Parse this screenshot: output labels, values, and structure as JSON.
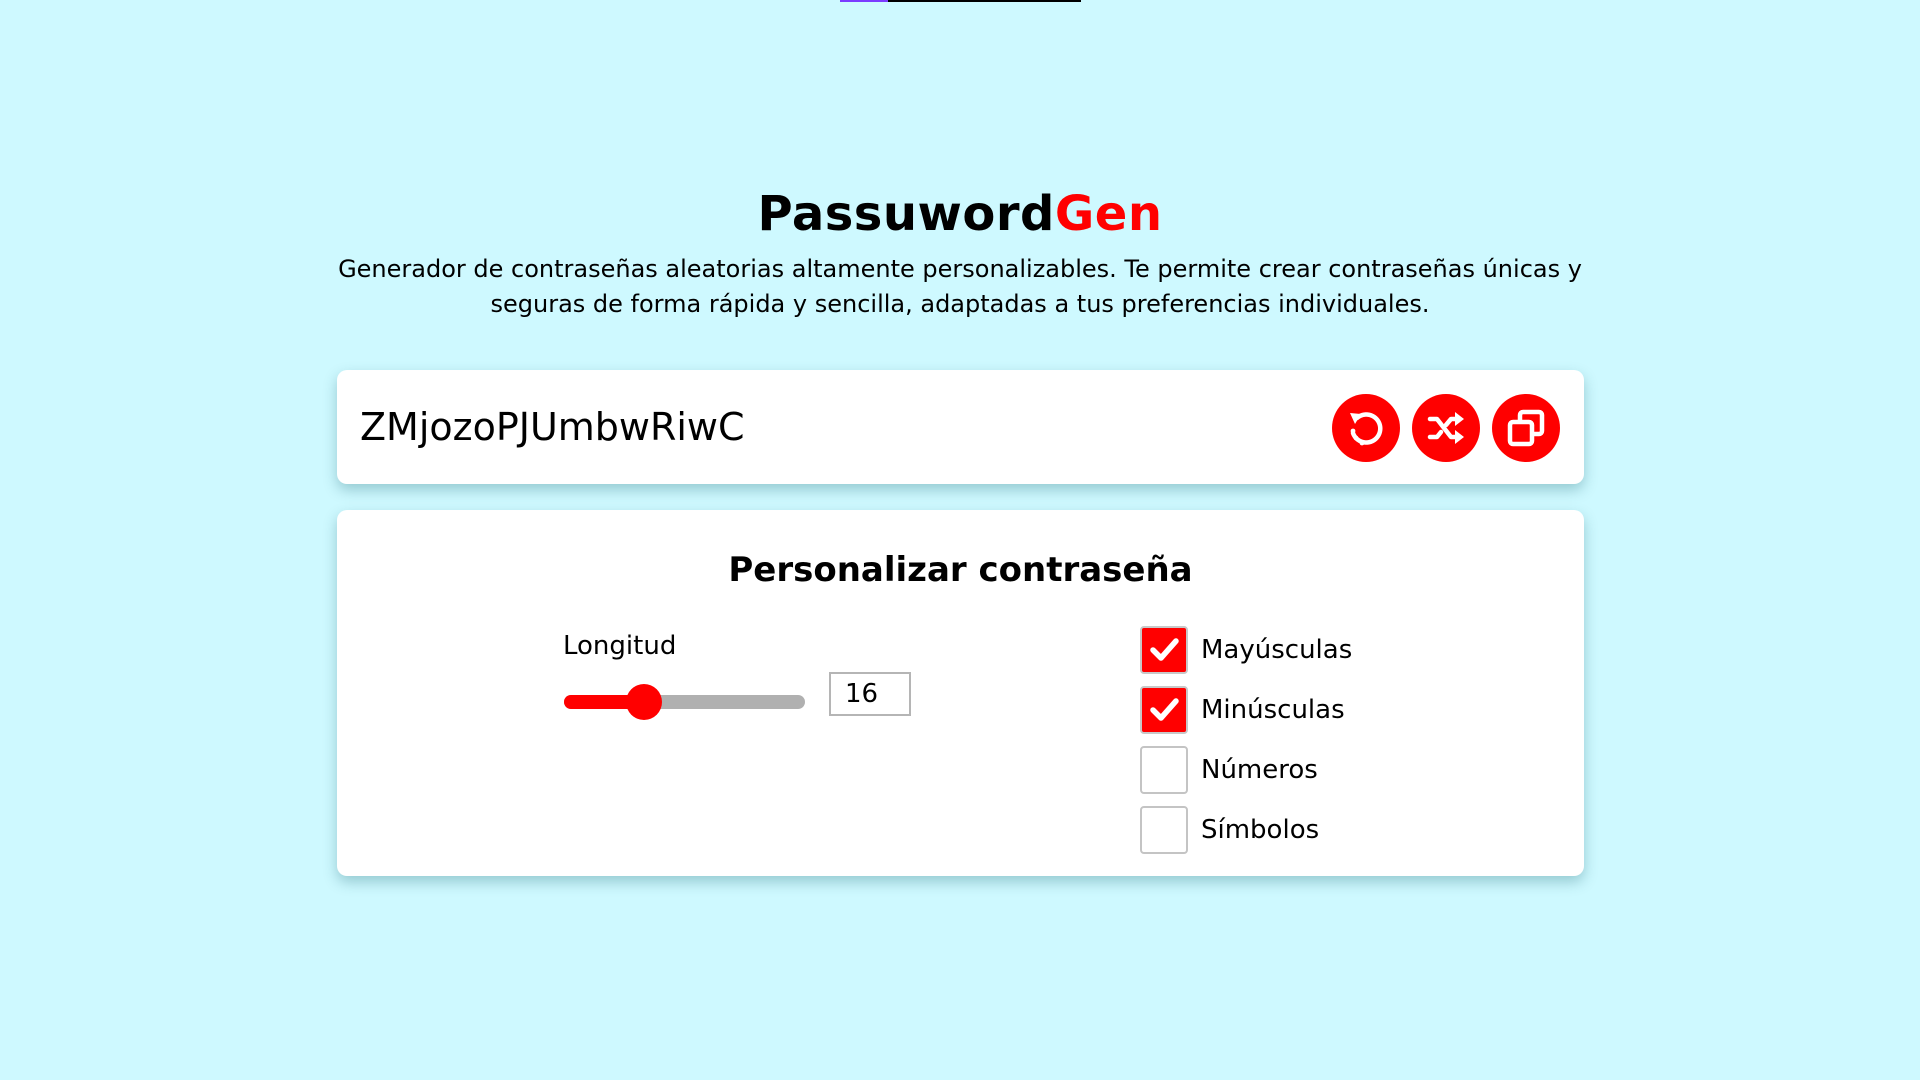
{
  "colors": {
    "background": "#cef9ff",
    "accent": "#ff0000",
    "card": "#ffffff"
  },
  "header": {
    "title_main": "Passuword",
    "title_accent": "Gen",
    "description": "Generador de contraseñas aleatorias altamente personalizables. Te permite crear contraseñas únicas y seguras de forma rápida y sencilla, adaptadas a tus preferencias individuales."
  },
  "password": {
    "value": "ZMjozoPJUmbwRiwC",
    "actions": [
      {
        "icon": "refresh-icon"
      },
      {
        "icon": "shuffle-icon"
      },
      {
        "icon": "copy-icon"
      }
    ]
  },
  "settings": {
    "title": "Personalizar contraseña",
    "length": {
      "label": "Longitud",
      "value": "16",
      "slider_fraction": 0.33
    },
    "options": [
      {
        "label": "Mayúsculas",
        "checked": true
      },
      {
        "label": "Minúsculas",
        "checked": true
      },
      {
        "label": "Números",
        "checked": false
      },
      {
        "label": "Símbolos",
        "checked": false
      }
    ]
  }
}
